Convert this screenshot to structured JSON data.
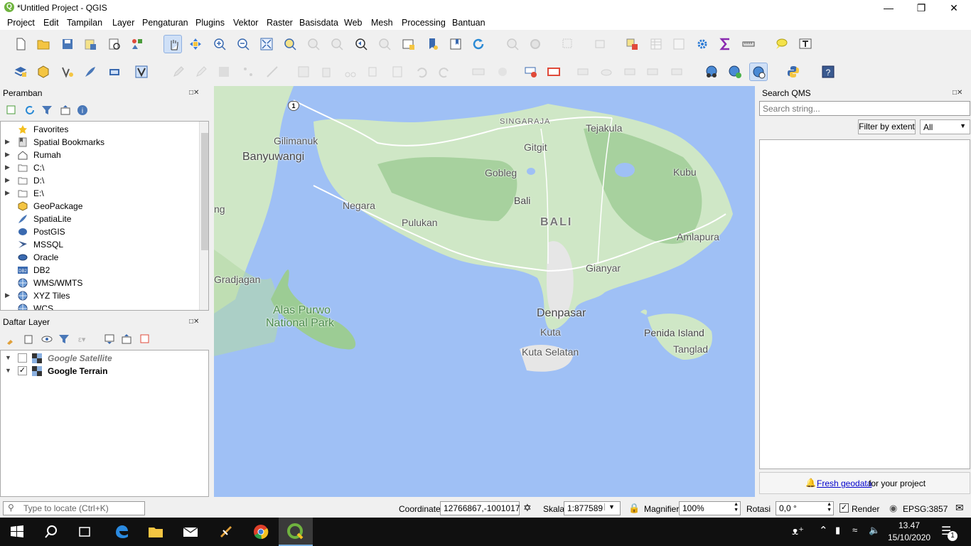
{
  "window": {
    "title": "*Untitled Project - QGIS",
    "min_icon": "minimize-icon",
    "max_icon": "maximize-icon",
    "close_icon": "close-icon"
  },
  "menu": [
    "Project",
    "Edit",
    "Tampilan",
    "Layer",
    "Pengaturan",
    "Plugins",
    "Vektor",
    "Raster",
    "Basisdata",
    "Web",
    "Mesh",
    "Processing",
    "Bantuan"
  ],
  "browser": {
    "title": "Peramban",
    "items": [
      {
        "label": "Favorites",
        "icon": "star-icon",
        "expandable": false
      },
      {
        "label": "Spatial Bookmarks",
        "icon": "bookmark-icon",
        "expandable": true
      },
      {
        "label": "Rumah",
        "icon": "home-icon",
        "expandable": true
      },
      {
        "label": "C:\\",
        "icon": "folder-icon",
        "expandable": true
      },
      {
        "label": "D:\\",
        "icon": "folder-icon",
        "expandable": true
      },
      {
        "label": "E:\\",
        "icon": "folder-icon",
        "expandable": true
      },
      {
        "label": "GeoPackage",
        "icon": "geopackage-icon",
        "expandable": false
      },
      {
        "label": "SpatiaLite",
        "icon": "spatialite-icon",
        "expandable": false
      },
      {
        "label": "PostGIS",
        "icon": "postgis-icon",
        "expandable": false
      },
      {
        "label": "MSSQL",
        "icon": "mssql-icon",
        "expandable": false
      },
      {
        "label": "Oracle",
        "icon": "oracle-icon",
        "expandable": false
      },
      {
        "label": "DB2",
        "icon": "db2-icon",
        "expandable": false
      },
      {
        "label": "WMS/WMTS",
        "icon": "globe-icon",
        "expandable": false
      },
      {
        "label": "XYZ Tiles",
        "icon": "globe-icon",
        "expandable": true
      },
      {
        "label": "WCS",
        "icon": "globe-icon",
        "expandable": false
      }
    ]
  },
  "layers": {
    "title": "Daftar Layer",
    "items": [
      {
        "label": "Google Satellite",
        "checked": false
      },
      {
        "label": "Google Terrain",
        "checked": true
      }
    ]
  },
  "map": {
    "labels": {
      "banyuwangi": "Banyuwangi",
      "gilimanuk": "Gilimanuk",
      "singaraja": "SINGARAJA",
      "tejakula": "Tejakula",
      "gitgit": "Gitgit",
      "gobleg": "Gobleg",
      "kubu": "Kubu",
      "negara": "Negara",
      "bali_town": "Bali",
      "bali": "BALI",
      "pulukan": "Pulukan",
      "amlapura": "Amlapura",
      "gianyar": "Gianyar",
      "gradjagan": "Gradjagan",
      "alas": "Alas Purwo",
      "national_park": "National Park",
      "denpasar": "Denpasar",
      "kuta": "Kuta",
      "kuta_selatan": "Kuta Selatan",
      "penida": "Penida Island",
      "tanglad": "Tanglad",
      "ng": "ng",
      "road": "1"
    }
  },
  "qms": {
    "title": "Search QMS",
    "search_placeholder": "Search string...",
    "filter_button": "Filter by extent",
    "filter_value": "All",
    "footer_link": "Fresh geodata",
    "footer_text": " for your project"
  },
  "status": {
    "locate_placeholder": "Type to locate (Ctrl+K)",
    "coordinate_label": "Coordinate",
    "coordinate_value": "12766867,-1001017",
    "scale_label": "Skala",
    "scale_value": "1:877589",
    "magnifier_label": "Magnifier",
    "magnifier_value": "100%",
    "rotation_label": "Rotasi",
    "rotation_value": "0,0 °",
    "render_label": "Render",
    "render_checked": true,
    "crs": "EPSG:3857"
  },
  "taskbar": {
    "time": "13.47",
    "date": "15/10/2020",
    "notification_count": "1"
  },
  "colors": {
    "land": "#cfe7c6",
    "water": "#9fc0f5",
    "urban": "#e8e8e8",
    "qgis_green": "#6fb33f"
  }
}
